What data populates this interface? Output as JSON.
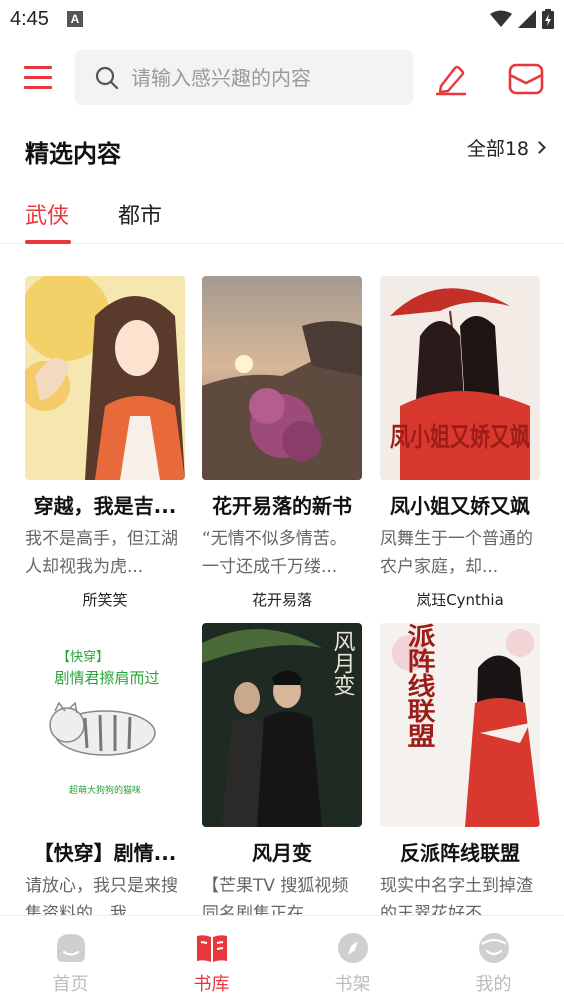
{
  "status_bar": {
    "time": "4:45",
    "notification_letter": "A"
  },
  "header": {
    "search_placeholder": "请输入感兴趣的内容"
  },
  "section": {
    "title": "精选内容",
    "view_all": "全部18"
  },
  "tabs": [
    {
      "label": "武侠",
      "active": true
    },
    {
      "label": "都市",
      "active": false
    }
  ],
  "books": [
    {
      "title": "穿越，我是吉...",
      "desc": "我不是高手，但江湖人却视我为虎...",
      "author": "所笑笑"
    },
    {
      "title": "花开易落的新书",
      "desc": "“无情不似多情苦。一寸还成千万缕...",
      "author": "花开易落"
    },
    {
      "title": "凤小姐又娇又飒",
      "desc": "凤舞生于一个普通的农户家庭，却...",
      "author": "岚珏Cynthia"
    },
    {
      "title": "【快穿】剧情...",
      "desc": "请放心，我只是来搜集资料的，我...",
      "author": ""
    },
    {
      "title": "风月变",
      "desc": "【芒果TV 搜狐视频 同名剧集正在...",
      "author": ""
    },
    {
      "title": "反派阵线联盟",
      "desc": "现实中名字土到掉渣的王翠花好不...",
      "author": ""
    }
  ],
  "cover_texts": {
    "book3": "凤小姐又娇又飒",
    "book4_tag": "【快穿】",
    "book4_line": "剧情君擦肩而过",
    "book4_bottom": "超萌大狗狗的猫咪",
    "book5": "风月变",
    "book6": "反派阵线联盟"
  },
  "bottom_nav": [
    {
      "label": "首页",
      "icon": "home-icon",
      "active": false
    },
    {
      "label": "书库",
      "icon": "library-icon",
      "active": true
    },
    {
      "label": "书架",
      "icon": "bookshelf-icon",
      "active": false
    },
    {
      "label": "我的",
      "icon": "profile-icon",
      "active": false
    }
  ],
  "colors": {
    "accent": "#e8383d",
    "inactive": "#bdbdbd"
  }
}
